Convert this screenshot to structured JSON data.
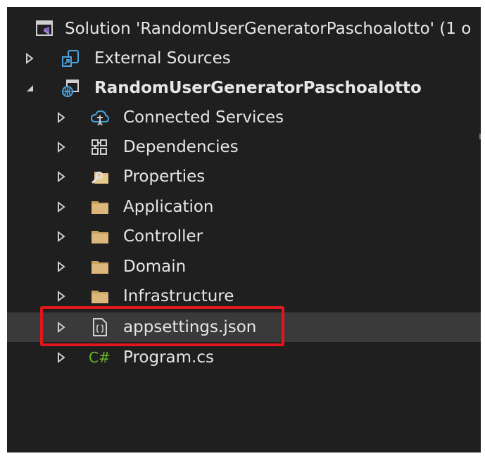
{
  "solution_label": "Solution 'RandomUserGeneratorPaschoalotto' (1 o",
  "items": [
    {
      "label": "External Sources",
      "icon": "external-sources-icon"
    },
    {
      "label": "RandomUserGeneratorPaschoalotto",
      "icon": "web-project-icon"
    },
    {
      "label": "Connected Services",
      "icon": "connected-services-icon"
    },
    {
      "label": "Dependencies",
      "icon": "dependencies-icon"
    },
    {
      "label": "Properties",
      "icon": "properties-icon"
    },
    {
      "label": "Application",
      "icon": "folder-icon"
    },
    {
      "label": "Controller",
      "icon": "folder-icon"
    },
    {
      "label": "Domain",
      "icon": "folder-icon"
    },
    {
      "label": "Infrastructure",
      "icon": "folder-icon"
    },
    {
      "label": "appsettings.json",
      "icon": "json-file-icon"
    },
    {
      "label": "Program.cs",
      "icon": "csharp-file-icon",
      "glyph": "C#"
    }
  ],
  "colors": {
    "background": "#1f1f1f",
    "text": "#e6e6e6",
    "selected_row": "#3a3a3a",
    "highlight_border": "#e0181e",
    "folder": "#dcb67a",
    "csharp": "#68b723",
    "vs_purple": "#8661c5",
    "blue_icon": "#4aa3df"
  }
}
